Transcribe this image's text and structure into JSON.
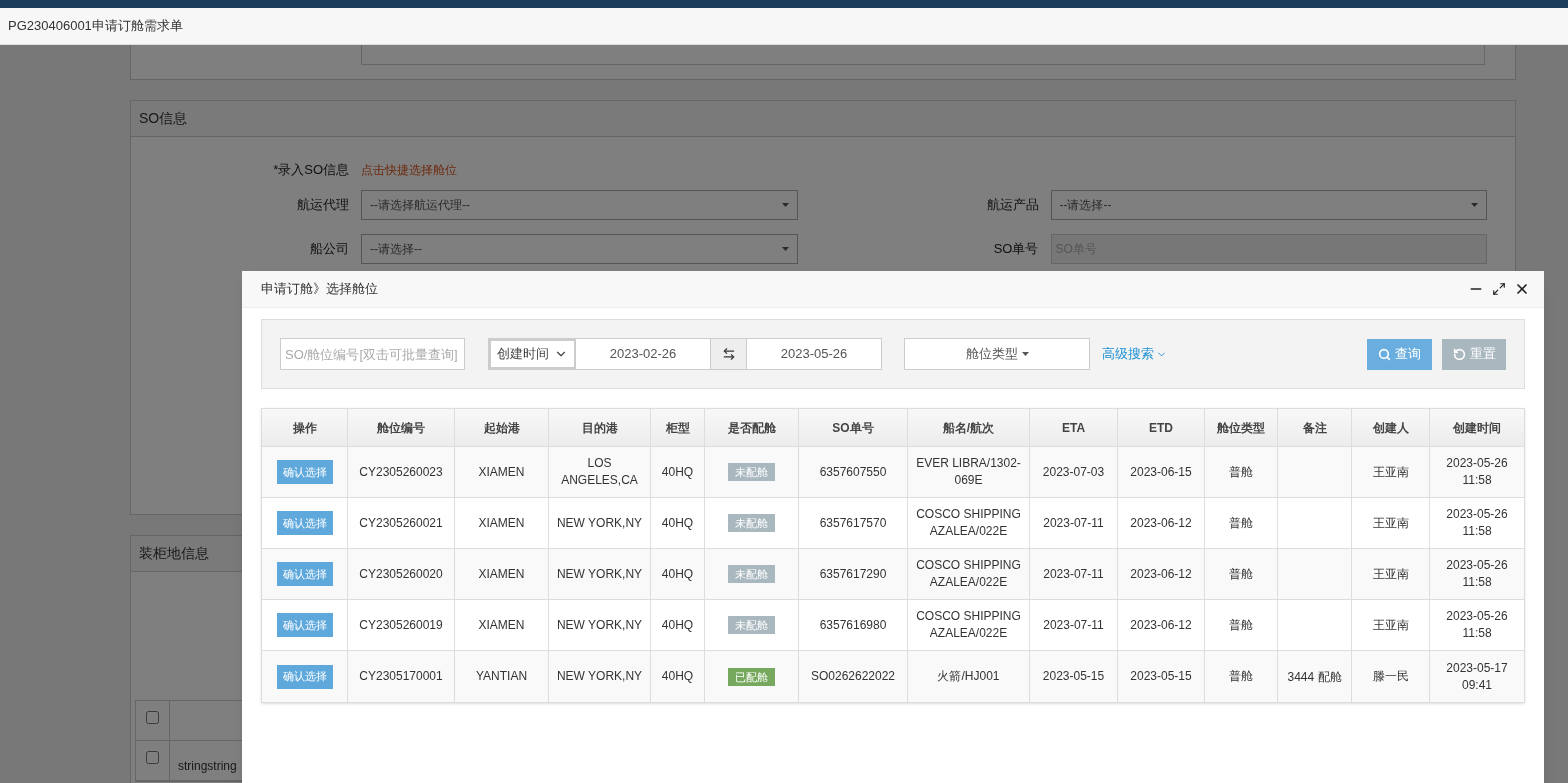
{
  "page_title": "PG230406001申请订舱需求单",
  "so_info": {
    "title": "SO信息",
    "entry_label": "*录入SO信息",
    "entry_link": "点击快捷选择舱位",
    "fields": [
      {
        "label": "航运代理",
        "kind": "select",
        "value": "--请选择航运代理--"
      },
      {
        "label": "航运产品",
        "kind": "select",
        "value": "--请选择--"
      },
      {
        "label": "船公司",
        "kind": "select",
        "value": "--请选择--"
      },
      {
        "label": "SO单号",
        "kind": "input",
        "placeholder": "SO单号"
      }
    ]
  },
  "loading_info": {
    "title": "装柜地信息",
    "rows": [
      {
        "checked": false
      },
      {
        "checked": false,
        "cell": "stringstring"
      }
    ]
  },
  "dialog": {
    "title": "申请订舱》选择舱位",
    "search": {
      "placeholder": "SO/舱位编号[双击可批量查询]",
      "date_field": "创建时间",
      "date_from": "2023-02-26",
      "date_to": "2023-05-26",
      "slot_type": "舱位类型",
      "advanced": "高级搜索",
      "query": "查询",
      "reset": "重置"
    },
    "columns": [
      "操作",
      "舱位编号",
      "起始港",
      "目的港",
      "柜型",
      "是否配舱",
      "SO单号",
      "船名/航次",
      "ETA",
      "ETD",
      "舱位类型",
      "备注",
      "创建人",
      "创建时间"
    ],
    "rows": [
      {
        "action": "确认选择",
        "slot_no": "CY2305260023",
        "origin": "XIAMEN",
        "destination": "LOS ANGELES,CA",
        "container": "40HQ",
        "status": {
          "label": "未配舱",
          "allocated": false
        },
        "so_no": "6357607550",
        "vessel": "EVER LIBRA/1302-069E",
        "eta": "2023-07-03",
        "etd": "2023-06-15",
        "slot_type": "普舱",
        "creator": "王亚南",
        "created": "2023-05-26 11:58"
      },
      {
        "action": "确认选择",
        "slot_no": "CY2305260021",
        "origin": "XIAMEN",
        "destination": "NEW YORK,NY",
        "container": "40HQ",
        "status": {
          "label": "未配舱",
          "allocated": false
        },
        "so_no": "6357617570",
        "vessel": "COSCO SHIPPING AZALEA/022E",
        "eta": "2023-07-11",
        "etd": "2023-06-12",
        "slot_type": "普舱",
        "creator": "王亚南",
        "created": "2023-05-26 11:58"
      },
      {
        "action": "确认选择",
        "slot_no": "CY2305260020",
        "origin": "XIAMEN",
        "destination": "NEW YORK,NY",
        "container": "40HQ",
        "status": {
          "label": "未配舱",
          "allocated": false
        },
        "so_no": "6357617290",
        "vessel": "COSCO SHIPPING AZALEA/022E",
        "eta": "2023-07-11",
        "etd": "2023-06-12",
        "slot_type": "普舱",
        "creator": "王亚南",
        "created": "2023-05-26 11:58"
      },
      {
        "action": "确认选择",
        "slot_no": "CY2305260019",
        "origin": "XIAMEN",
        "destination": "NEW YORK,NY",
        "container": "40HQ",
        "status": {
          "label": "未配舱",
          "allocated": false
        },
        "so_no": "6357616980",
        "vessel": "COSCO SHIPPING AZALEA/022E",
        "eta": "2023-07-11",
        "etd": "2023-06-12",
        "slot_type": "普舱",
        "creator": "王亚南",
        "created": "2023-05-26 11:58"
      },
      {
        "action": "确认选择",
        "slot_no": "CY2305170001",
        "origin": "YANTIAN",
        "destination": "NEW YORK,NY",
        "container": "40HQ",
        "status": {
          "label": "已配舱",
          "allocated": true
        },
        "so_no": "SO0262622022",
        "vessel": "火箭/HJ001",
        "eta": "2023-05-15",
        "etd": "2023-05-15",
        "slot_type": "普舱",
        "remark": "3444 配舱",
        "creator": "滕一民",
        "created": "2023-05-17 09:41"
      }
    ]
  }
}
